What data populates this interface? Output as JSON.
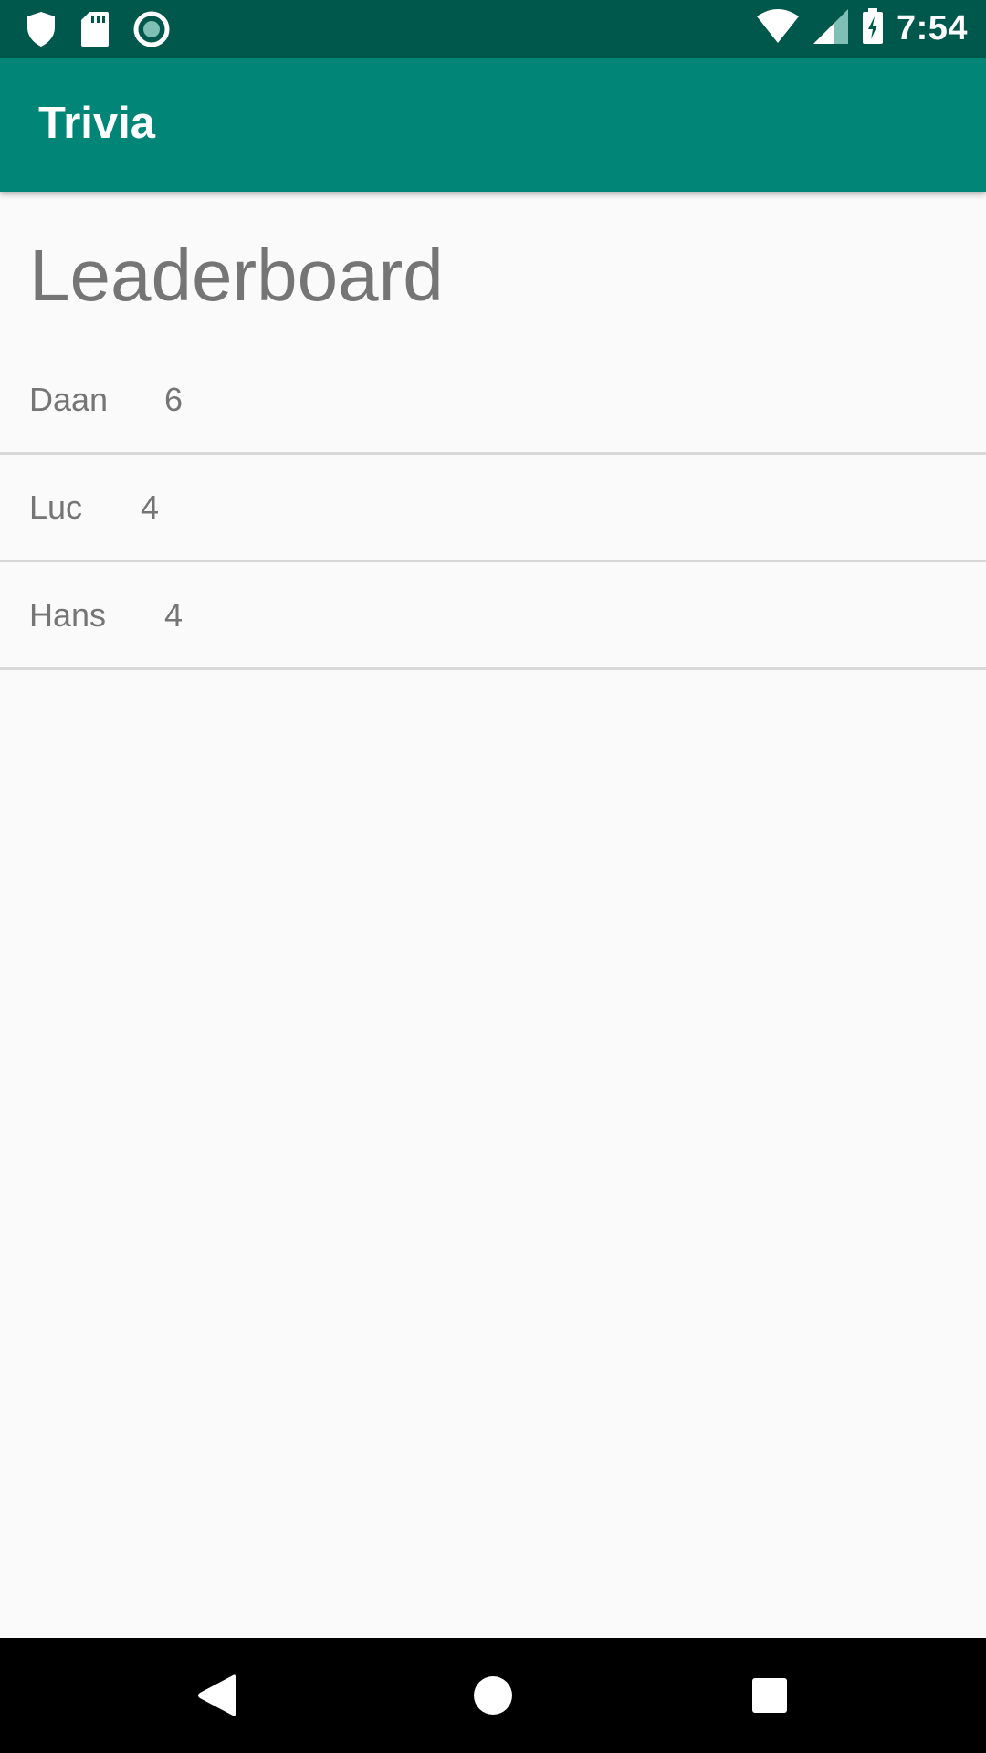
{
  "status_bar": {
    "time": "7:54",
    "icons": [
      "shield-icon",
      "sd-card-icon",
      "record-icon",
      "wifi-icon",
      "signal-icon",
      "battery-charging-icon"
    ]
  },
  "app_bar": {
    "title": "Trivia"
  },
  "page": {
    "title": "Leaderboard"
  },
  "leaderboard": [
    {
      "name": "Daan",
      "score": "6"
    },
    {
      "name": "Luc",
      "score": "4"
    },
    {
      "name": "Hans",
      "score": "4"
    }
  ],
  "nav_bar": {
    "icons": [
      "back-icon",
      "home-icon",
      "recents-icon"
    ]
  },
  "colors": {
    "status_bar": "#00574b",
    "app_bar": "#008577",
    "background": "#fafafa",
    "text": "#757575"
  }
}
